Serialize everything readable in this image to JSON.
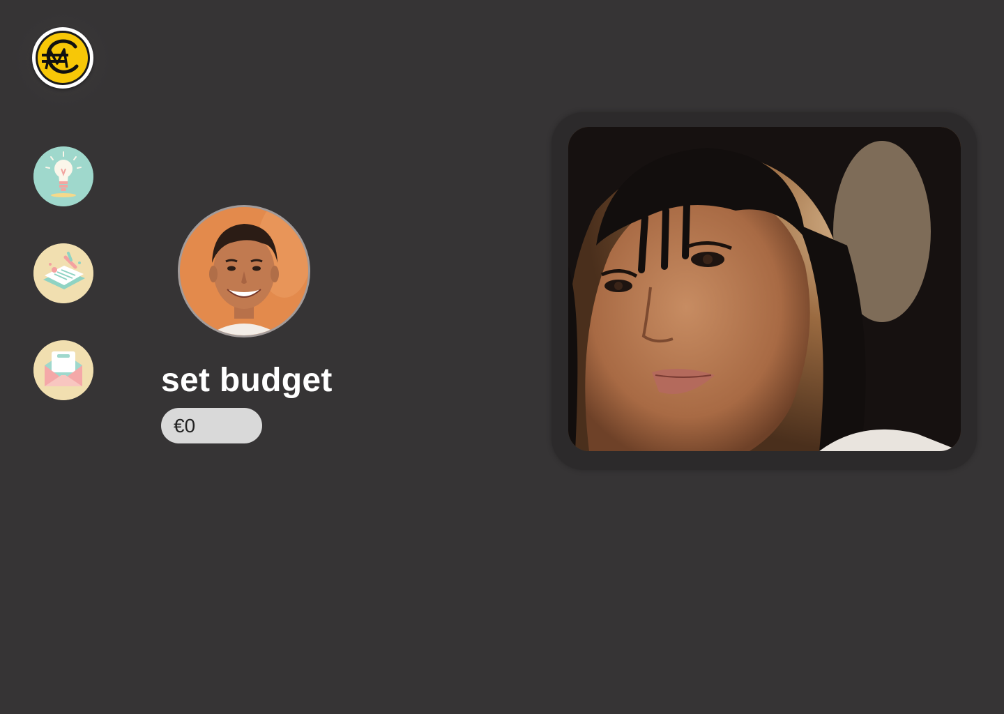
{
  "app": {
    "logo_icon": "euro-coin-logo-icon",
    "logo_color": "#f7c707"
  },
  "sidebar": {
    "items": [
      {
        "name": "ideas",
        "icon": "lightbulb-icon",
        "color": "#9fd8cc"
      },
      {
        "name": "planner",
        "icon": "planner-notebook-icon",
        "color": "#f1dfb0"
      },
      {
        "name": "mail",
        "icon": "envelope-icon",
        "color": "#f1dfb0"
      }
    ]
  },
  "profile": {
    "avatar_icon": "user-avatar"
  },
  "budget": {
    "title": "set budget",
    "value": "€0"
  },
  "feature_photo": {
    "icon": "portrait-photo"
  },
  "colors": {
    "background": "#363435",
    "frame": "#2c2a2b",
    "input_bg": "#d9d9d9",
    "text": "#ffffff"
  }
}
